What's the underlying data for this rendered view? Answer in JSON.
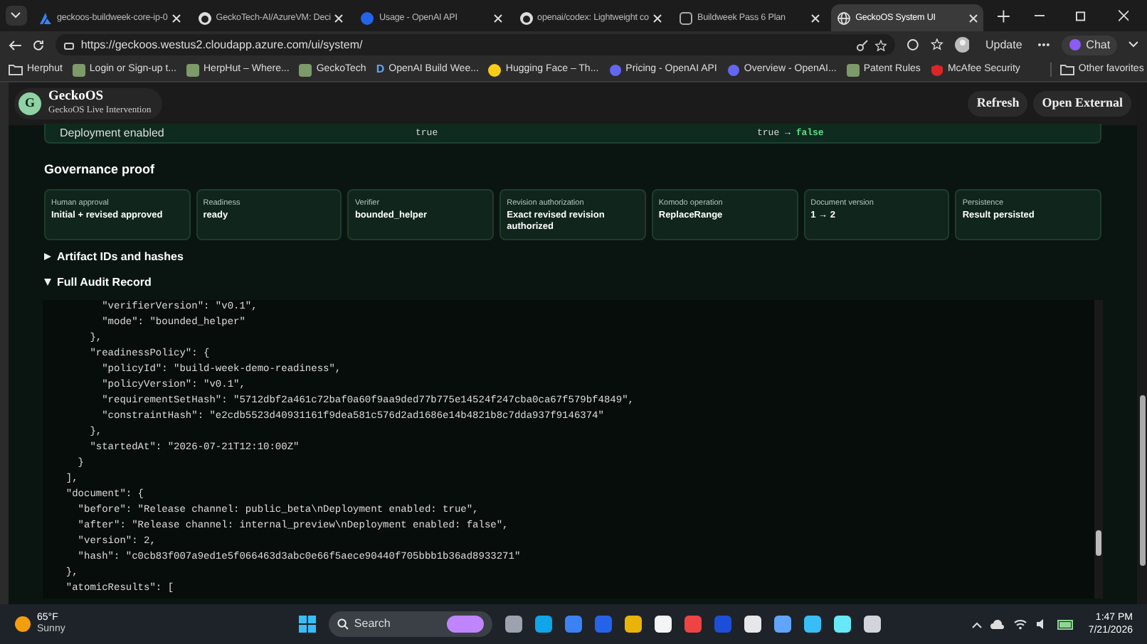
{
  "browser": {
    "tabs": [
      {
        "title": "geckoos-buildweek-core-ip-0",
        "selected": false,
        "kind": "azure"
      },
      {
        "title": "GeckoTech-AI/AzureVM: Deci",
        "selected": false,
        "kind": "github"
      },
      {
        "title": "Usage - OpenAI API",
        "selected": false,
        "kind": "openai"
      },
      {
        "title": "openai/codex: Lightweight co",
        "selected": false,
        "kind": "github"
      },
      {
        "title": "Buildweek Pass 6 Plan",
        "selected": false,
        "kind": "doc"
      },
      {
        "title": "GeckoOS System UI",
        "selected": true,
        "kind": "globe"
      }
    ],
    "url": "https://geckoos.westus2.cloudapp.azure.com/ui/system/",
    "update_label": "Update",
    "chat_label": "Chat",
    "bookmarks": [
      {
        "label": "Herphut",
        "kind": "folder"
      },
      {
        "label": "Login or Sign-up t...",
        "kind": "site"
      },
      {
        "label": "HerpHut – Where...",
        "kind": "site"
      },
      {
        "label": "GeckoTech",
        "kind": "site"
      },
      {
        "label": "OpenAI Build Wee...",
        "kind": "letter",
        "letter": "D"
      },
      {
        "label": "Hugging Face – Th...",
        "kind": "emoji"
      },
      {
        "label": "Pricing - OpenAI API",
        "kind": "circle"
      },
      {
        "label": "Overview - OpenAI...",
        "kind": "circle"
      },
      {
        "label": "Patent Rules",
        "kind": "site"
      },
      {
        "label": "McAfee Security",
        "kind": "shield"
      }
    ],
    "other_favorites": "Other favorites"
  },
  "app": {
    "avatar_letter": "G",
    "brand": "GeckoOS",
    "subtitle": "GeckoOS Live Intervention",
    "buttons": [
      "Refresh",
      "Open External"
    ],
    "deployment": {
      "label": "Deployment enabled",
      "before": "true",
      "after_from": "true",
      "arrow": "→",
      "after_to": "false"
    },
    "governance": {
      "title": "Governance proof",
      "cards": [
        {
          "label": "Human approval",
          "value": "Initial + revised approved"
        },
        {
          "label": "Readiness",
          "value": "ready"
        },
        {
          "label": "Verifier",
          "value": "bounded_helper"
        },
        {
          "label": "Revision authorization",
          "value": "Exact revised revision authorized"
        },
        {
          "label": "Komodo operation",
          "value": "ReplaceRange"
        },
        {
          "label": "Document version",
          "value": "1 → 2"
        },
        {
          "label": "Persistence",
          "value": "Result persisted"
        }
      ]
    },
    "sections": [
      {
        "label": "Artifact IDs and hashes",
        "expanded": false
      },
      {
        "label": "Full Audit Record",
        "expanded": true
      }
    ],
    "audit_lines": [
      "        \"verifierVersion\": \"v0.1\",",
      "        \"mode\": \"bounded_helper\"",
      "      },",
      "      \"readinessPolicy\": {",
      "        \"policyId\": \"build-week-demo-readiness\",",
      "        \"policyVersion\": \"v0.1\",",
      "        \"requirementSetHash\": \"5712dbf2a461c72baf0a60f9aa9ded77b775e14524f247cba0ca67f579bf4849\",",
      "        \"constraintHash\": \"e2cdb5523d40931161f9dea581c576d2ad1686e14b4821b8c7dda937f9146374\"",
      "      },",
      "      \"startedAt\": \"2026-07-21T12:10:00Z\"",
      "    }",
      "  ],",
      "  \"document\": {",
      "    \"before\": \"Release channel: public_beta\\nDeployment enabled: true\",",
      "    \"after\": \"Release channel: internal_preview\\nDeployment enabled: false\",",
      "    \"version\": 2,",
      "    \"hash\": \"c0cb83f007a9ed1e5f066463d3abc0e66f5aece90440f705bbb1b36ad8933271\"",
      "  },",
      "  \"atomicResults\": ["
    ]
  },
  "taskbar": {
    "temperature": "65°F",
    "weather": "Sunny",
    "search_placeholder": "Search",
    "time": "1:47 PM",
    "date": "7/21/2026"
  }
}
